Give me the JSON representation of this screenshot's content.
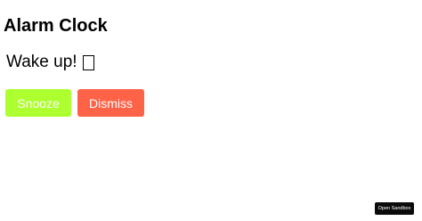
{
  "app": {
    "title": "Alarm Clock"
  },
  "alarm": {
    "message": "Wake up!",
    "glyph": "?"
  },
  "actions": {
    "snooze_label": "Snooze",
    "dismiss_label": "Dismiss"
  },
  "sandbox": {
    "open_label": "Open Sandbox"
  },
  "colors": {
    "snooze_bg": "#adff2f",
    "dismiss_bg": "#ff6347",
    "sandbox_bg": "#0b0b0b"
  }
}
